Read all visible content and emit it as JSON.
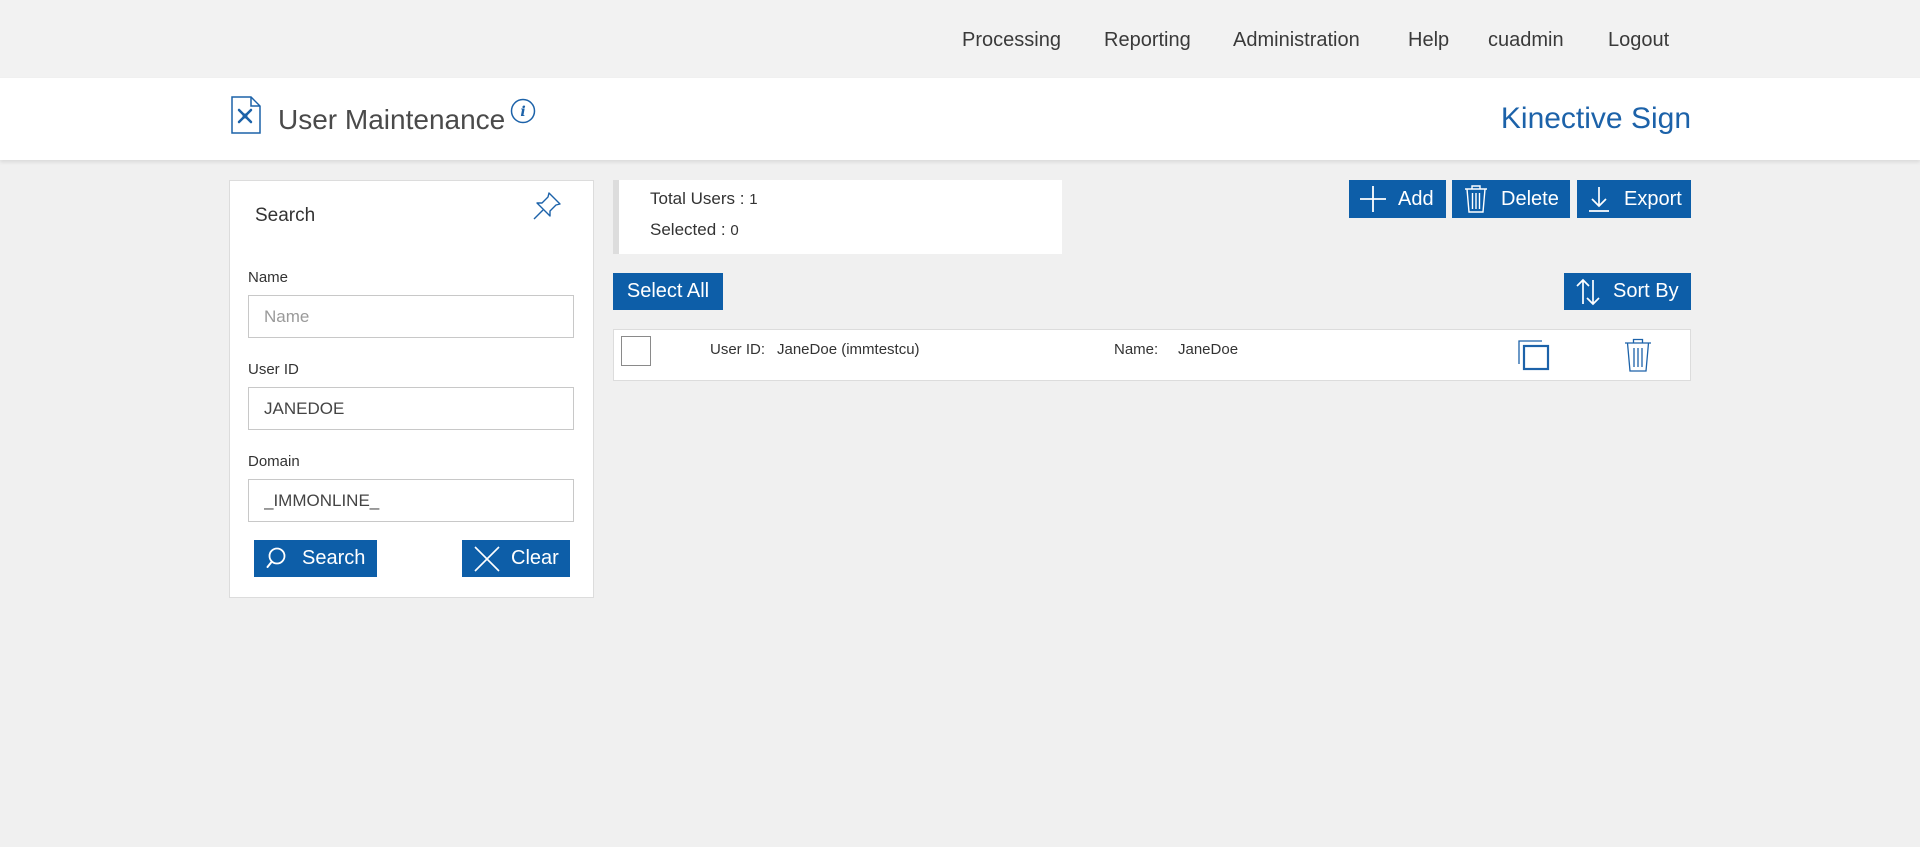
{
  "nav": {
    "items": [
      "Processing",
      "Reporting",
      "Administration",
      "Help",
      "cuadmin",
      "Logout"
    ]
  },
  "header": {
    "title": "User Maintenance",
    "brand": "Kinective Sign"
  },
  "search": {
    "title": "Search",
    "name_label": "Name",
    "name_placeholder": "Name",
    "name_value": "",
    "userid_label": "User ID",
    "userid_value": "JANEDOE",
    "domain_label": "Domain",
    "domain_value": "_IMMONLINE_",
    "search_button": "Search",
    "clear_button": "Clear"
  },
  "summary": {
    "total_label": "Total Users :",
    "total_value": "1",
    "selected_label": "Selected :",
    "selected_value": "0"
  },
  "actions": {
    "add": "Add",
    "delete": "Delete",
    "export": "Export",
    "select_all": "Select All",
    "sort_by": "Sort By"
  },
  "results": [
    {
      "userid_label": "User ID:",
      "userid_value": "JaneDoe (immtestcu)",
      "name_label": "Name:",
      "name_value": "JaneDoe"
    }
  ],
  "colors": {
    "accent": "#0d5ea8",
    "brand": "#1c62a9",
    "background": "#f0f0f0"
  },
  "icons": [
    "page-tools-icon",
    "info-icon",
    "pin-icon",
    "search-icon",
    "close-icon",
    "plus-icon",
    "trash-icon",
    "download-icon",
    "sort-icon",
    "copy-icon"
  ]
}
